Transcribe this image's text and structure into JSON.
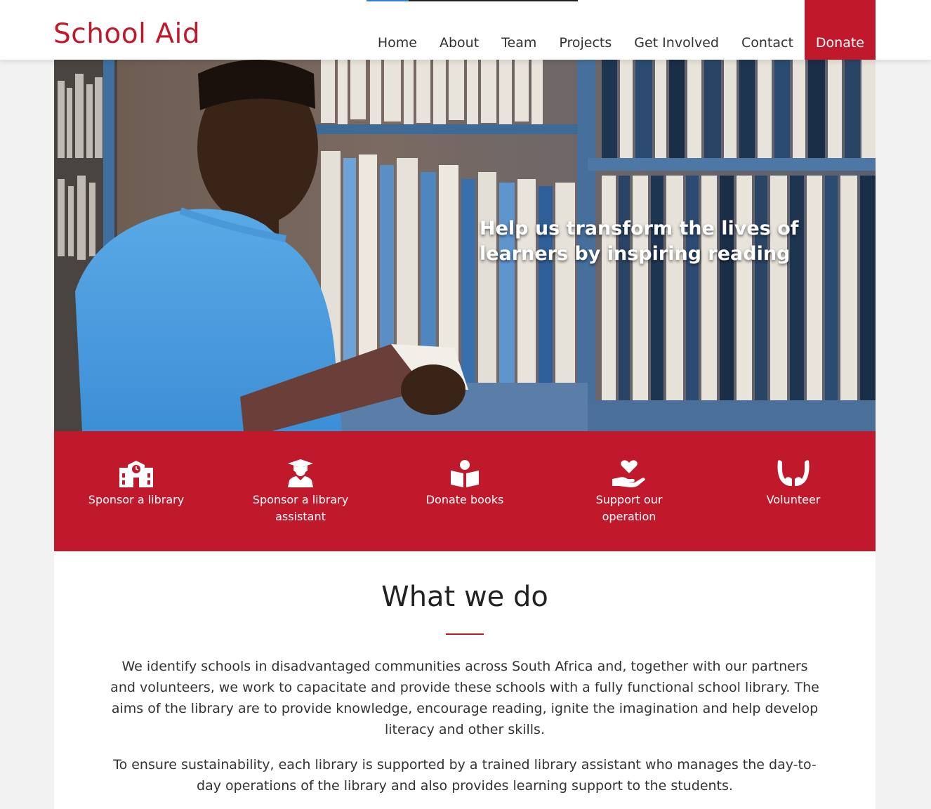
{
  "brand": {
    "name": "School Aid",
    "primary_color": "#c0192b"
  },
  "nav": {
    "items": [
      {
        "label": "Home"
      },
      {
        "label": "About"
      },
      {
        "label": "Team"
      },
      {
        "label": "Projects"
      },
      {
        "label": "Get Involved"
      },
      {
        "label": "Contact"
      }
    ],
    "donate_label": "Donate"
  },
  "hero": {
    "title": "Help us transform the lives of learners by inspiring reading"
  },
  "actions": [
    {
      "label": "Sponsor a library",
      "icon": "school-icon"
    },
    {
      "label": "Sponsor a library assistant",
      "icon": "graduate-icon"
    },
    {
      "label": "Donate books",
      "icon": "book-reader-icon"
    },
    {
      "label": "Support our operation",
      "icon": "hand-heart-icon"
    },
    {
      "label": "Volunteer",
      "icon": "hands-icon"
    }
  ],
  "what_we_do": {
    "title": "What we do",
    "paragraphs": [
      "We identify schools in disadvantaged communities across South Africa and, together with our partners and volunteers, we work to capacitate and provide these schools with a fully functional school library. The aims of the library are to provide knowledge, encourage reading, ignite the imagination and help develop literacy and other skills.",
      "To ensure sustainability, each library is supported by a trained library assistant who manages the day-to-day operations of the library and also provides learning support to the students."
    ]
  }
}
